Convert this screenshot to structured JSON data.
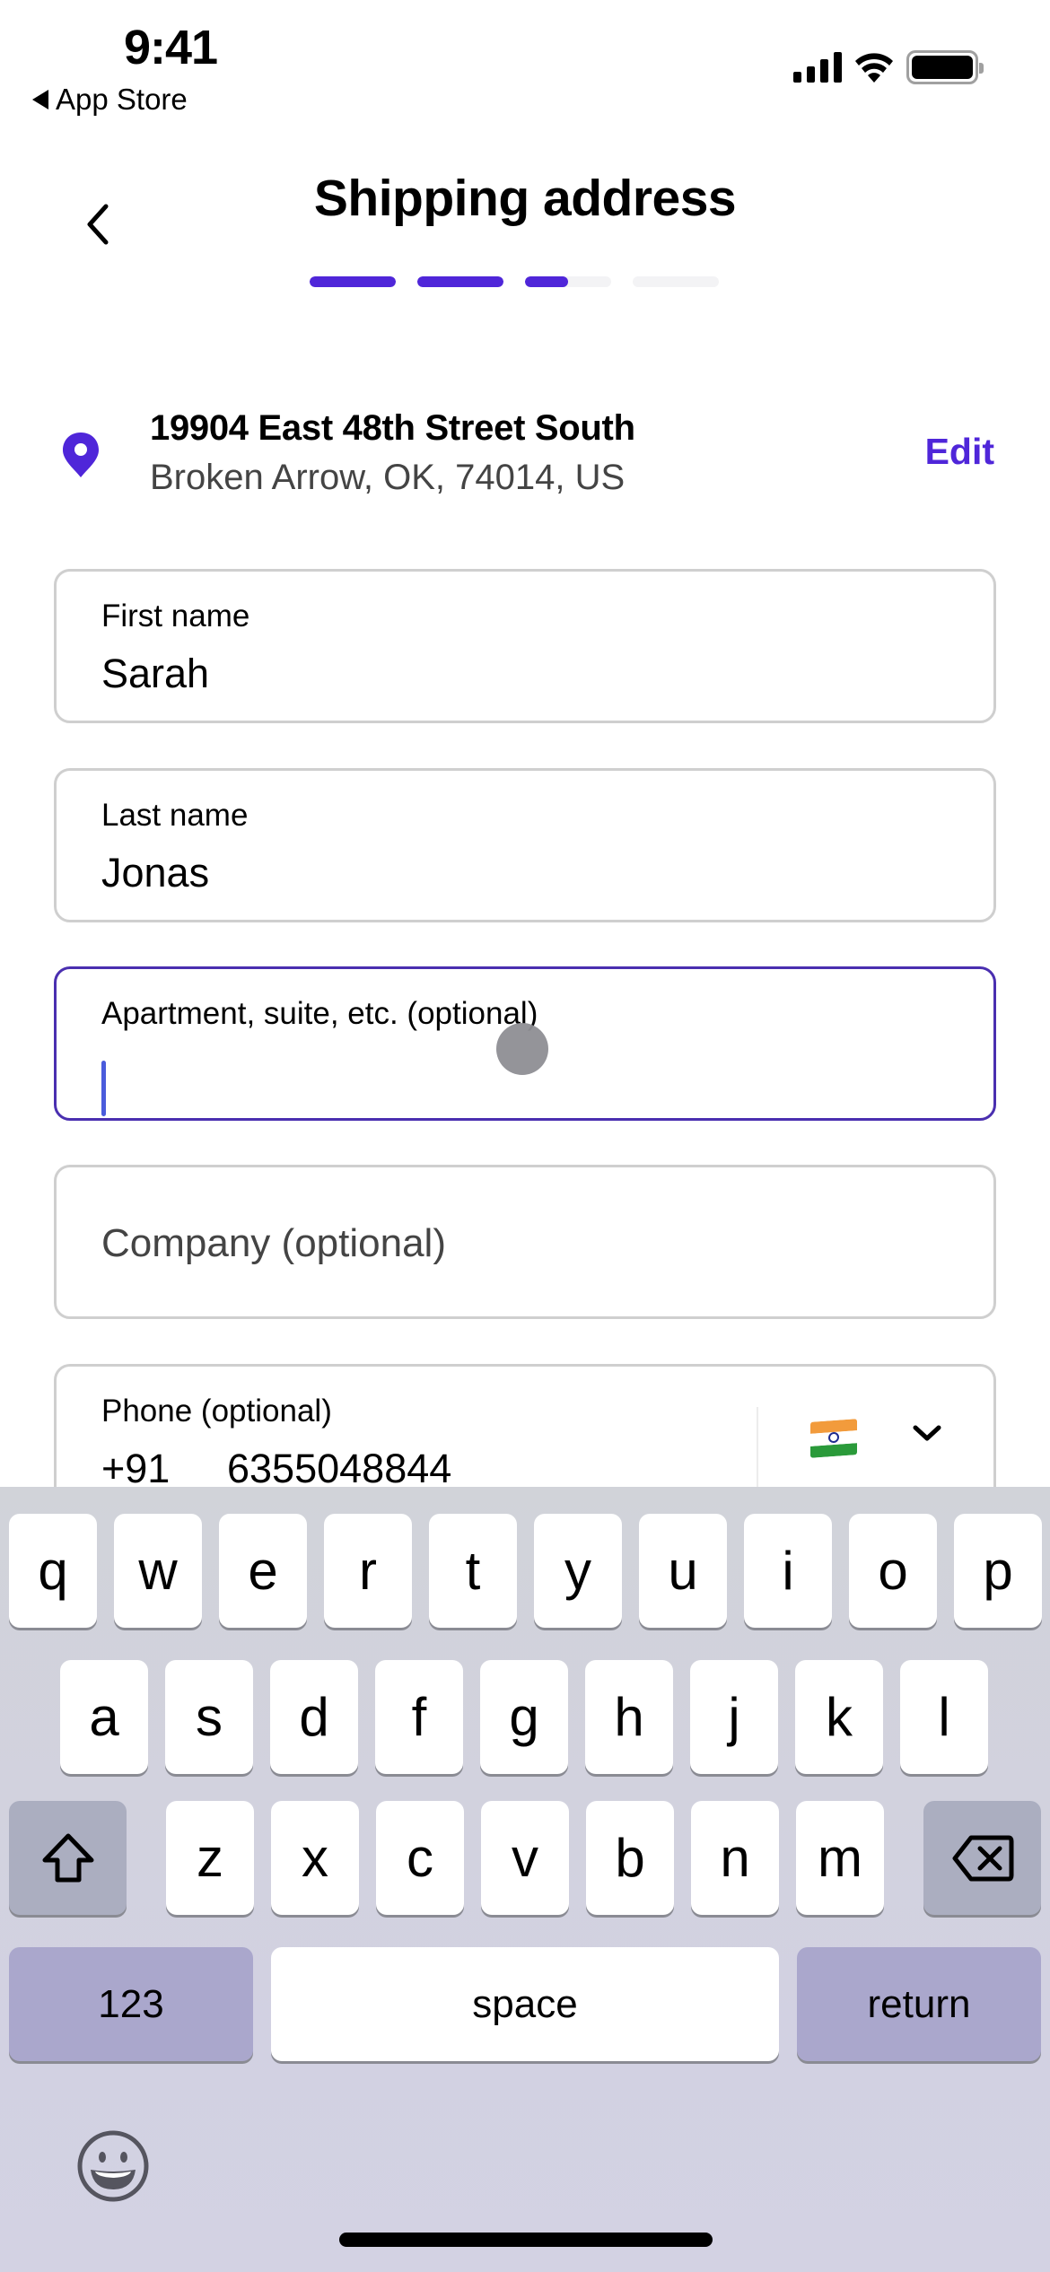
{
  "status_bar": {
    "time": "9:41",
    "back_app": "App Store",
    "icons": [
      "cellular-signal-icon",
      "wifi-icon",
      "battery-icon"
    ]
  },
  "header": {
    "back_icon": "chevron-left-icon",
    "title": "Shipping address",
    "steps": [
      {
        "progress": 1.0
      },
      {
        "progress": 1.0
      },
      {
        "progress": 0.5
      },
      {
        "progress": 0.0
      }
    ]
  },
  "address": {
    "icon": "location-pin-icon",
    "line1": "19904 East 48th Street South",
    "line2": "Broken Arrow, OK, 74014, US",
    "edit_label": "Edit"
  },
  "form": {
    "first_name": {
      "label": "First name",
      "value": "Sarah"
    },
    "last_name": {
      "label": "Last name",
      "value": "Jonas"
    },
    "apartment": {
      "label": "Apartment, suite, etc. (optional)",
      "value": "",
      "focused": true
    },
    "company": {
      "placeholder": "Company (optional)",
      "value": ""
    },
    "phone": {
      "label": "Phone (optional)",
      "country_code": "+91",
      "number": "6355048844",
      "country_flag": "india-flag-icon",
      "dropdown_icon": "chevron-down-icon"
    }
  },
  "keyboard": {
    "row1": [
      "q",
      "w",
      "e",
      "r",
      "t",
      "y",
      "u",
      "i",
      "o",
      "p"
    ],
    "row2": [
      "a",
      "s",
      "d",
      "f",
      "g",
      "h",
      "j",
      "k",
      "l"
    ],
    "row3": [
      "z",
      "x",
      "c",
      "v",
      "b",
      "n",
      "m"
    ],
    "shift_icon": "shift-icon",
    "delete_icon": "delete-icon",
    "numbers_label": "123",
    "space_label": "space",
    "return_label": "return",
    "emoji_icon": "emoji-icon"
  },
  "colors": {
    "accent": "#4f26d9",
    "focus_border": "#4a2fb0",
    "caret": "#4a5bdc"
  }
}
